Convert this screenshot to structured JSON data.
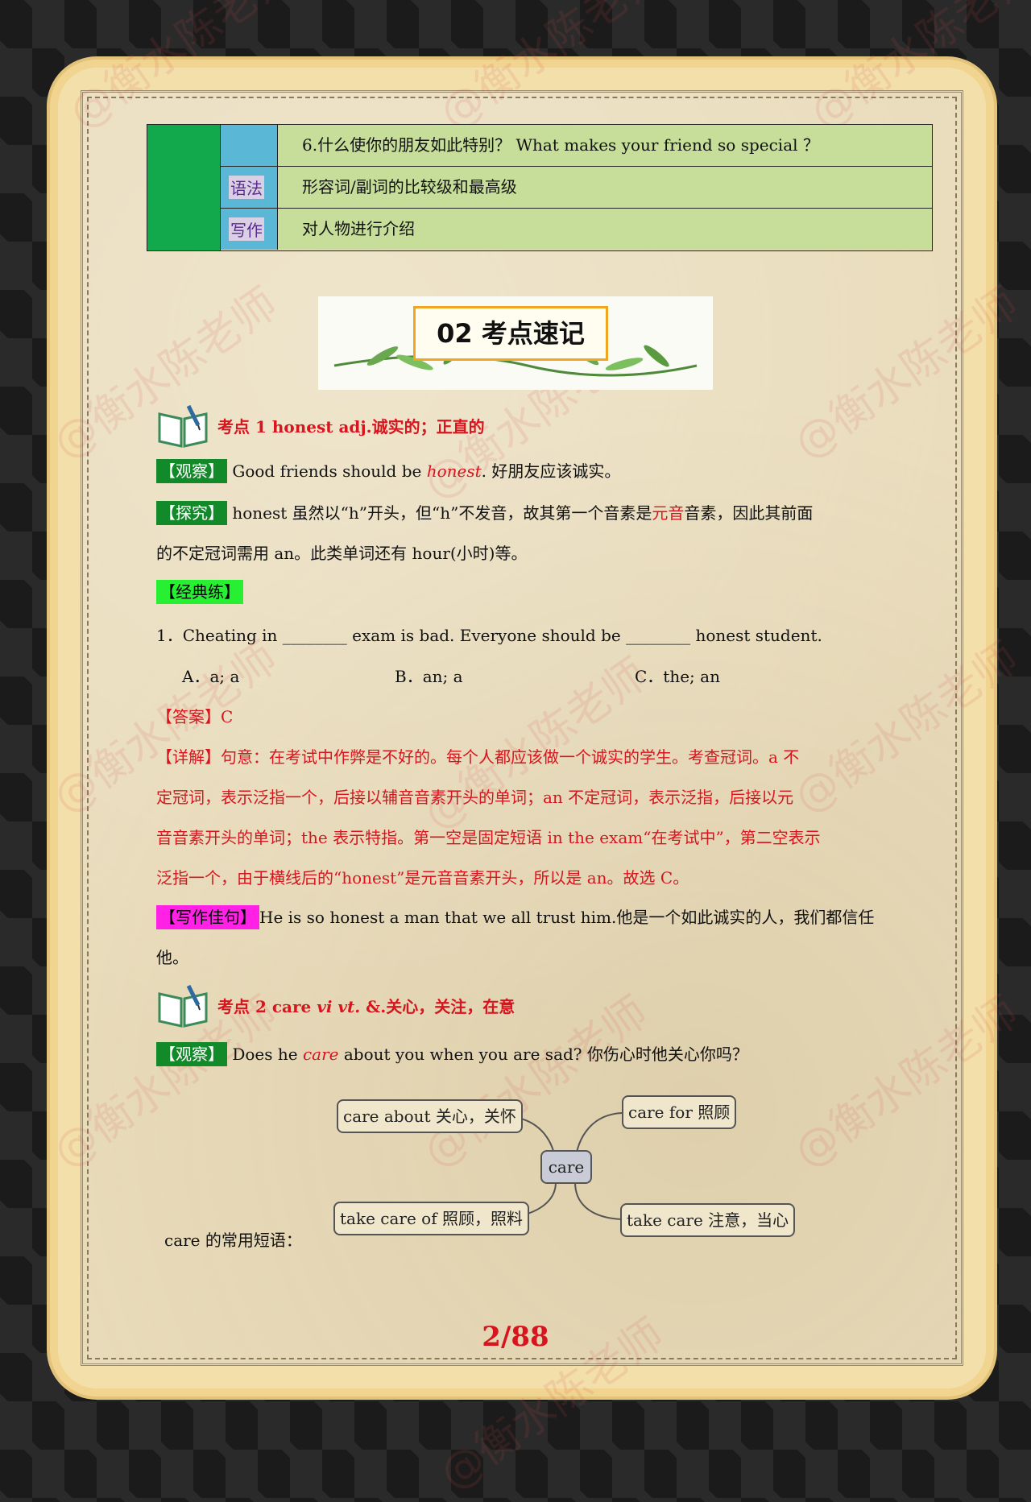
{
  "top_table": {
    "rows": [
      {
        "label": "",
        "text": "6.什么使你的朋友如此特别？ What makes your friend so special ？"
      },
      {
        "label": "语法",
        "text": "形容词/副词的比较级和最高级"
      },
      {
        "label": "写作",
        "text": "对人物进行介绍"
      }
    ]
  },
  "banner": {
    "title": "02 考点速记"
  },
  "watermark": "@衡水陈老师",
  "point1": {
    "heading": "考点 1 honest adj.诚实的；正直的",
    "observe_tag": "【观察】",
    "observe_pre": "Good friends should be ",
    "observe_word": "honest",
    "observe_post": ".   好朋友应该诚实。",
    "explore_tag": "【探究】",
    "explore_line1_a": "honest 虽然以“h”开头，但“h”不发音，故其第一个音素是",
    "explore_line1_red": "元音",
    "explore_line1_b": "音素，因此其前面",
    "explore_line2": "的不定冠词需用 an。此类单词还有 hour(小时)等。",
    "practice_tag": "【经典练】",
    "question": "1．Cheating in ________ exam is bad. Everyone should be ________ honest student.",
    "options": [
      "A．a; a",
      "B．an; a",
      "C．the; an"
    ],
    "answer": "【答案】C",
    "detail_lines": [
      "【详解】句意：在考试中作弊是不好的。每个人都应该做一个诚实的学生。考查冠词。a 不",
      "定冠词，表示泛指一个，后接以辅音音素开头的单词；an 不定冠词，表示泛指，后接以元",
      "音音素开头的单词；the 表示特指。第一空是固定短语 in the exam“在考试中”，第二空表示",
      "泛指一个，由于横线后的“honest”是元音音素开头，所以是 an。故选 C。"
    ],
    "writing_tag": "【写作佳句】",
    "writing_line1": "He is so honest a man that we all trust him.他是一个如此诚实的人，我们都信任",
    "writing_line2": "他。"
  },
  "point2": {
    "heading_a": "考点 2 care ",
    "heading_b": "vi vt.",
    "heading_c": " &.关心，关注，在意",
    "observe_tag": "【观察】",
    "observe_pre": "Does he ",
    "observe_word": "care",
    "observe_post": " about you when you are sad?   你伤心时他关心你吗？",
    "mindmap": {
      "center": "care",
      "nodes": [
        "care about 关心，关怀",
        "care for 照顾",
        "take care of 照顾，照料",
        "take care 注意，当心"
      ]
    },
    "phrases_label": "care 的常用短语："
  },
  "page_number": "2/88"
}
